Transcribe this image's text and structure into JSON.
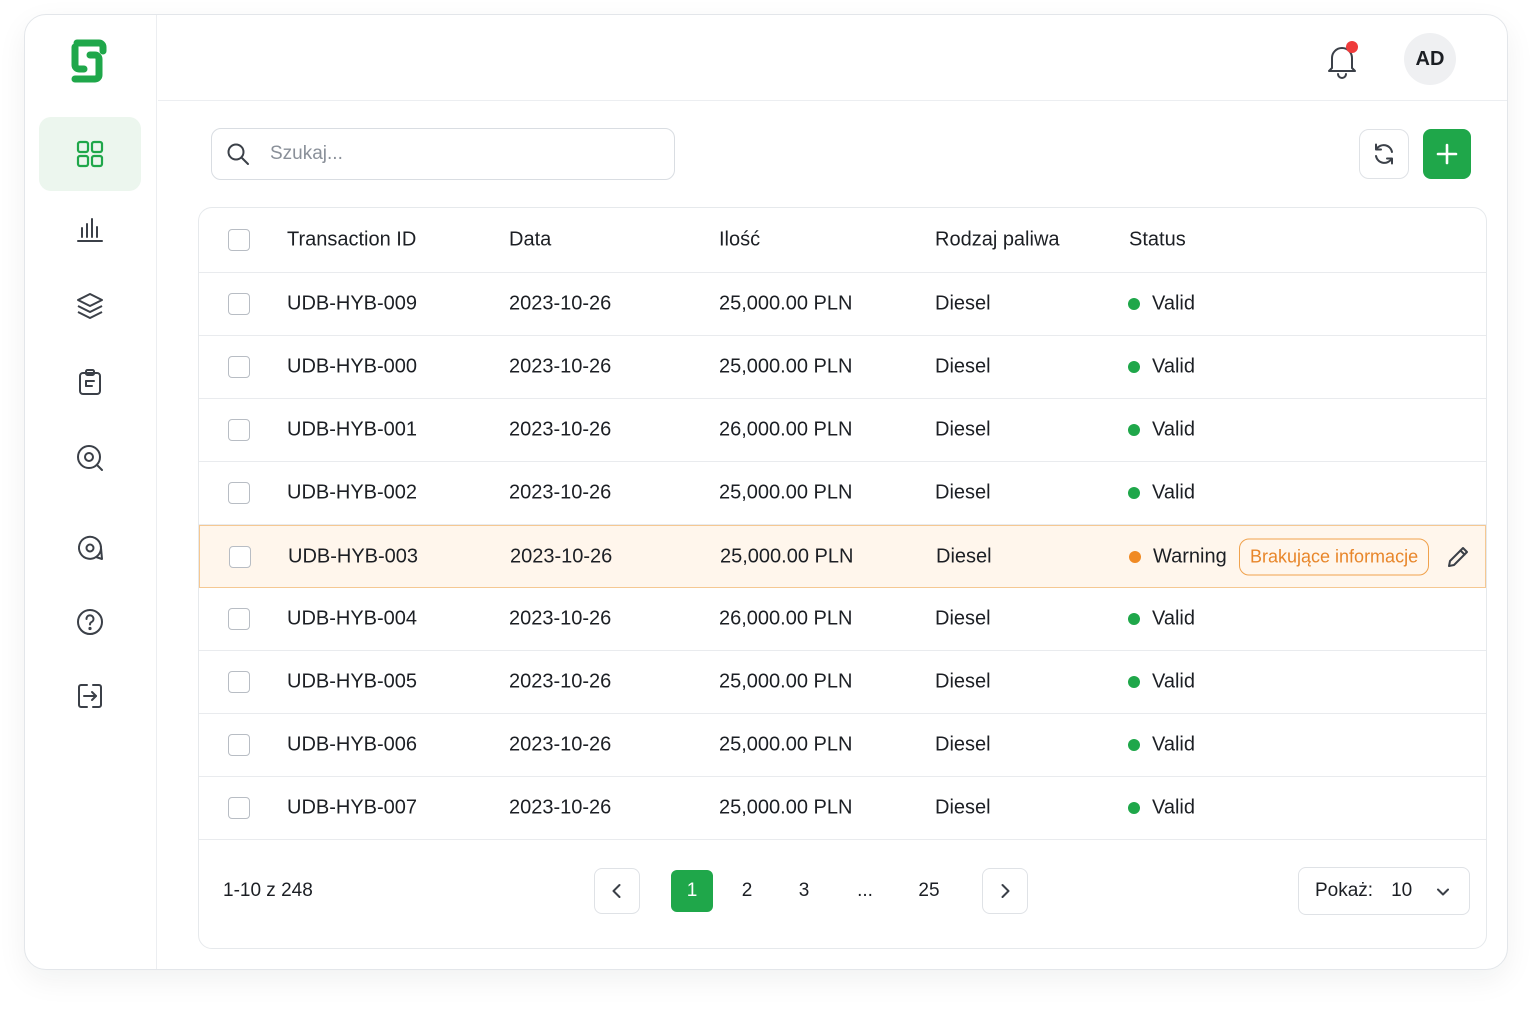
{
  "header": {
    "avatar_initials": "AD",
    "notification_dot_color": "#ef3b3b"
  },
  "sidebar": {
    "items": [
      {
        "icon": "dashboard-grid-icon",
        "active": true
      },
      {
        "icon": "bar-chart-icon",
        "active": false
      },
      {
        "icon": "layers-icon",
        "active": false
      },
      {
        "icon": "clipboard-icon",
        "active": false
      },
      {
        "icon": "search-target-icon",
        "active": false
      },
      {
        "icon": "chat-support-icon",
        "active": false
      },
      {
        "icon": "help-circle-icon",
        "active": false
      },
      {
        "icon": "logout-icon",
        "active": false
      }
    ]
  },
  "toolbar": {
    "search_placeholder": "Szukaj..."
  },
  "table": {
    "columns": [
      "Transaction ID",
      "Data",
      "Ilość",
      "Rodzaj paliwa",
      "Status"
    ],
    "rows": [
      {
        "id": "UDB-HYB-009",
        "date": "2023-10-26",
        "amount": "25,000.00 PLN",
        "fuel": "Diesel",
        "status": "Valid",
        "status_color": "#1fa74a"
      },
      {
        "id": "UDB-HYB-000",
        "date": "2023-10-26",
        "amount": "25,000.00 PLN",
        "fuel": "Diesel",
        "status": "Valid",
        "status_color": "#1fa74a"
      },
      {
        "id": "UDB-HYB-001",
        "date": "2023-10-26",
        "amount": "26,000.00 PLN",
        "fuel": "Diesel",
        "status": "Valid",
        "status_color": "#1fa74a"
      },
      {
        "id": "UDB-HYB-002",
        "date": "2023-10-26",
        "amount": "25,000.00 PLN",
        "fuel": "Diesel",
        "status": "Valid",
        "status_color": "#1fa74a"
      },
      {
        "id": "UDB-HYB-003",
        "date": "2023-10-26",
        "amount": "25,000.00 PLN",
        "fuel": "Diesel",
        "status": "Warning",
        "status_color": "#f08a24",
        "tag": "Brakujące informacje"
      },
      {
        "id": "UDB-HYB-004",
        "date": "2023-10-26",
        "amount": "26,000.00 PLN",
        "fuel": "Diesel",
        "status": "Valid",
        "status_color": "#1fa74a"
      },
      {
        "id": "UDB-HYB-005",
        "date": "2023-10-26",
        "amount": "25,000.00 PLN",
        "fuel": "Diesel",
        "status": "Valid",
        "status_color": "#1fa74a"
      },
      {
        "id": "UDB-HYB-006",
        "date": "2023-10-26",
        "amount": "25,000.00 PLN",
        "fuel": "Diesel",
        "status": "Valid",
        "status_color": "#1fa74a"
      },
      {
        "id": "UDB-HYB-007",
        "date": "2023-10-26",
        "amount": "25,000.00 PLN",
        "fuel": "Diesel",
        "status": "Valid",
        "status_color": "#1fa74a"
      }
    ]
  },
  "pagination": {
    "range_text": "1-10 z 248",
    "pages": [
      "1",
      "2",
      "3",
      "...",
      "25"
    ],
    "current_page": "1",
    "show_label": "Pokaż:",
    "show_value": "10"
  },
  "colors": {
    "accent": "#1fa74a",
    "warning": "#f08a24",
    "warning_bg": "#fff6ec"
  }
}
